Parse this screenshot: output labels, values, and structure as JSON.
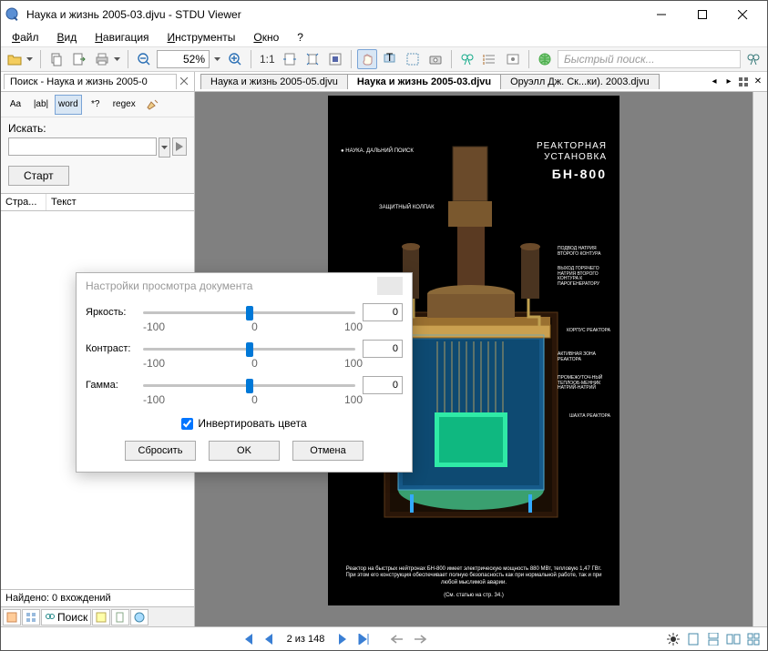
{
  "window": {
    "title": "Наука и жизнь 2005-03.djvu - STDU Viewer"
  },
  "menu": {
    "file": "Файл",
    "view": "Вид",
    "nav": "Навигация",
    "tools": "Инструменты",
    "window": "Окно",
    "help": "?"
  },
  "toolbar": {
    "zoom": "52%",
    "quicksearch_placeholder": "Быстрый поиск..."
  },
  "left_panel": {
    "tab_label": "Поиск - Наука и жизнь 2005-0",
    "search_label": "Искать:",
    "search_value": "",
    "start_label": "Старт",
    "col_page": "Стра...",
    "col_text": "Текст",
    "found_label": "Найдено: 0 вхождений",
    "modes": {
      "aa": "Aa",
      "abi": "|ab|",
      "word": "word",
      "star": "*?",
      "regex": "regex"
    },
    "bottom_tab": "Поиск"
  },
  "doc_tabs": {
    "t1": "Наука и жизнь 2005-05.djvu",
    "t2": "Наука и жизнь 2005-03.djvu",
    "t3": "Оруэлл Дж. Ск...ки). 2003.djvu"
  },
  "page": {
    "section": "● НАУКА. ДАЛЬНИЙ ПОИСК",
    "title_l1": "РЕАКТОРНАЯ",
    "title_l2": "УСТАНОВКА",
    "title_big": "БН-800",
    "label_shield": "ЗАЩИТНЫЙ КОЛПАК",
    "label_r1": "ПОДВОД НАТРИЯ ВТОРОГО КОНТУРА",
    "label_r2": "ВЫХОД ГОРЯЧЕГО НАТРИЯ ВТОРОГО КОНТУРА К ПАРОГЕНЕРАТОРУ",
    "label_r3": "КОРПУС РЕАКТОРА",
    "label_r4": "АКТИВНАЯ ЗОНА РЕАКТОРА",
    "label_r5": "ПРОМЕЖУТОЧ-НЫЙ ТЕПЛООБ-МЕННИК НАТРИЙ-НАТРИЙ",
    "label_r6": "ШАХТА РЕАКТОРА",
    "caption": "Реактор на быстрых нейтронах БН-800 имеет электрическую мощность 880 МВт, тепловую 1,47 ГВт. При этом его конструкция обеспечивает полную безопасность как при нормальной работе, так и при любой мыслимой аварии.",
    "seealso": "(См. статью на стр. 34.)"
  },
  "nav": {
    "page_indicator": "2 из 148"
  },
  "dialog": {
    "title": "Настройки просмотра документа",
    "brightness_label": "Яркость:",
    "contrast_label": "Контраст:",
    "gamma_label": "Гамма:",
    "brightness_value": "0",
    "contrast_value": "0",
    "gamma_value": "0",
    "tick_min": "-100",
    "tick_mid": "0",
    "tick_max": "100",
    "invert_label": "Инвертировать цвета",
    "reset": "Сбросить",
    "ok": "OK",
    "cancel": "Отмена"
  }
}
